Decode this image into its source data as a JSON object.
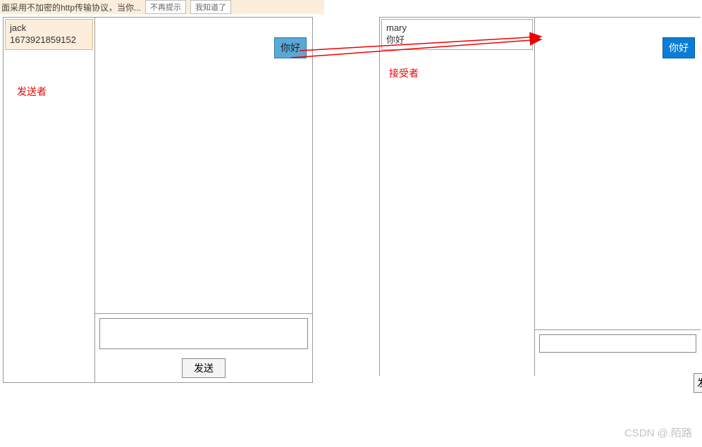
{
  "topbar": {
    "text_partial": "面采用不加密的http传输协议，当你...",
    "btn1": "不再提示",
    "btn2": "我知道了"
  },
  "left": {
    "contact_name": "jack",
    "contact_id": "1673921859152",
    "message_text": "你好",
    "send_label": "发送"
  },
  "right": {
    "contact_name": "mary",
    "contact_sub": "你好",
    "message_text": "你好",
    "send_label": "发"
  },
  "annotations": {
    "sender": "发送者",
    "receiver": "接受者"
  },
  "watermark": "CSDN @.陌路"
}
